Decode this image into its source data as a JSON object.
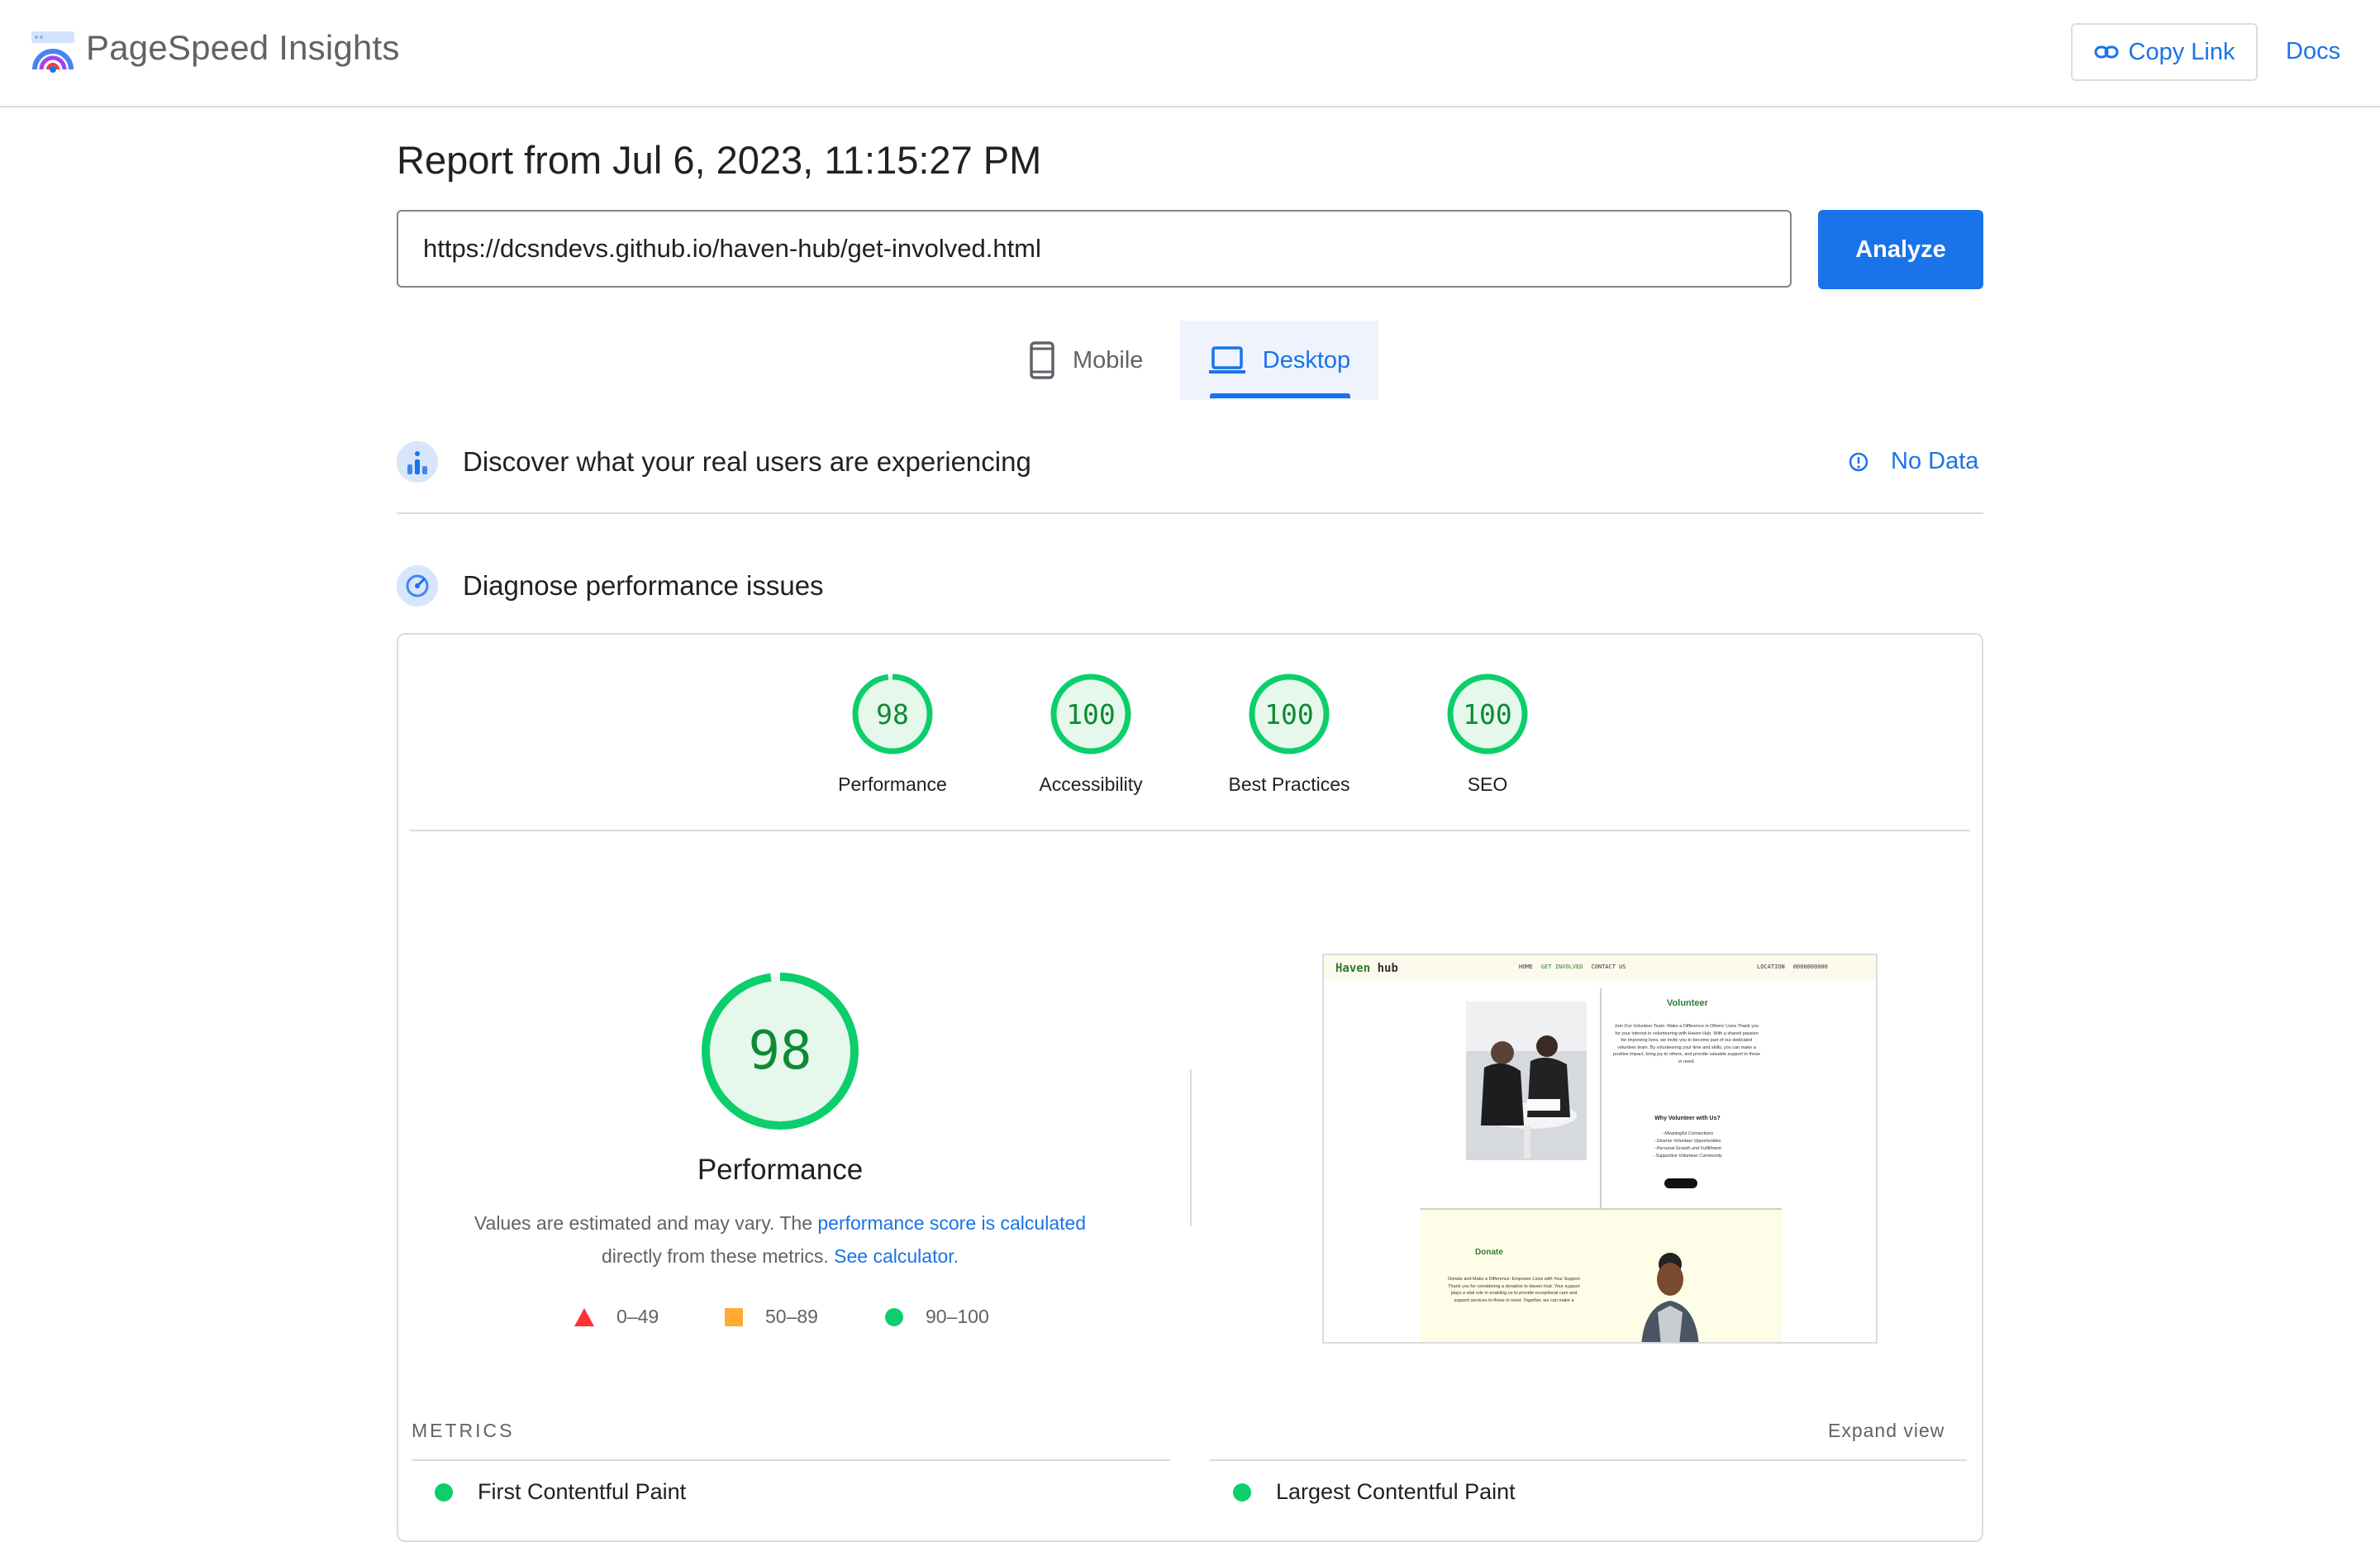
{
  "header": {
    "app_title": "PageSpeed Insights",
    "copy_link_label": "Copy Link",
    "docs_label": "Docs"
  },
  "report": {
    "title": "Report from Jul 6, 2023, 11:15:27 PM",
    "url": "https://dcsndevs.github.io/haven-hub/get-involved.html",
    "analyze_label": "Analyze"
  },
  "tabs": [
    {
      "label": "Mobile",
      "selected": false,
      "icon": "phone-icon"
    },
    {
      "label": "Desktop",
      "selected": true,
      "icon": "laptop-icon"
    }
  ],
  "field_data": {
    "title": "Discover what your real users are experiencing",
    "status": "No Data"
  },
  "diagnose": {
    "title": "Diagnose performance issues"
  },
  "scores": [
    {
      "label": "Performance",
      "value": "98"
    },
    {
      "label": "Accessibility",
      "value": "100"
    },
    {
      "label": "Best Practices",
      "value": "100"
    },
    {
      "label": "SEO",
      "value": "100"
    }
  ],
  "main_score": {
    "value": "98",
    "label": "Performance",
    "desc_1": "Values are estimated and may vary. The ",
    "desc_link_1": "performance score is calculated",
    "desc_2": "directly from these metrics. ",
    "desc_link_2": "See calculator."
  },
  "legend": [
    {
      "range": "0–49",
      "shape": "triangle",
      "color": "#ff3333"
    },
    {
      "range": "50–89",
      "shape": "square",
      "color": "#ffaa33"
    },
    {
      "range": "90–100",
      "shape": "circle",
      "color": "#0cce6b"
    }
  ],
  "colors": {
    "accent": "#1a73e8",
    "pass": "#0cce6b",
    "pass_text": "#0d8a35",
    "pass_fill": "#e6f7ec"
  },
  "screenshot": {
    "site_logo_1": "Haven",
    "site_logo_2": "hub",
    "nav": [
      "HOME",
      "GET INVOLVED",
      "CONTACT US"
    ],
    "nav_right": [
      "LOCATION",
      "0000000000"
    ],
    "volunteer_heading": "Volunteer",
    "volunteer_text": "Join Our Volunteer Team: Make a Difference in Others' Lives Thank you for your interest in volunteering with Haven Hub. With a shared passion for improving lives, we invite you to become part of our dedicated volunteer team. By volunteering your time and skills, you can make a positive impact, bring joy to others, and provide valuable support to those in need.",
    "why_heading": "Why Volunteer with Us?",
    "why_items": [
      "- Meaningful Connections",
      "- Diverse Volunteer Opportunities",
      "- Personal Growth and Fulfillment",
      "- Supportive Volunteer Community"
    ],
    "donate_heading": "Donate",
    "donate_text": "Donate and Make a Difference: Empower Lives with Your Support Thank you for considering a donation to Haven Hub. Your support plays a vital role in enabling us to provide exceptional care and support services to those in need. Together, we can make a"
  },
  "metrics": {
    "section_label": "METRICS",
    "expand_label": "Expand view",
    "items": [
      {
        "label": "First Contentful Paint"
      },
      {
        "label": "Largest Contentful Paint"
      }
    ]
  }
}
